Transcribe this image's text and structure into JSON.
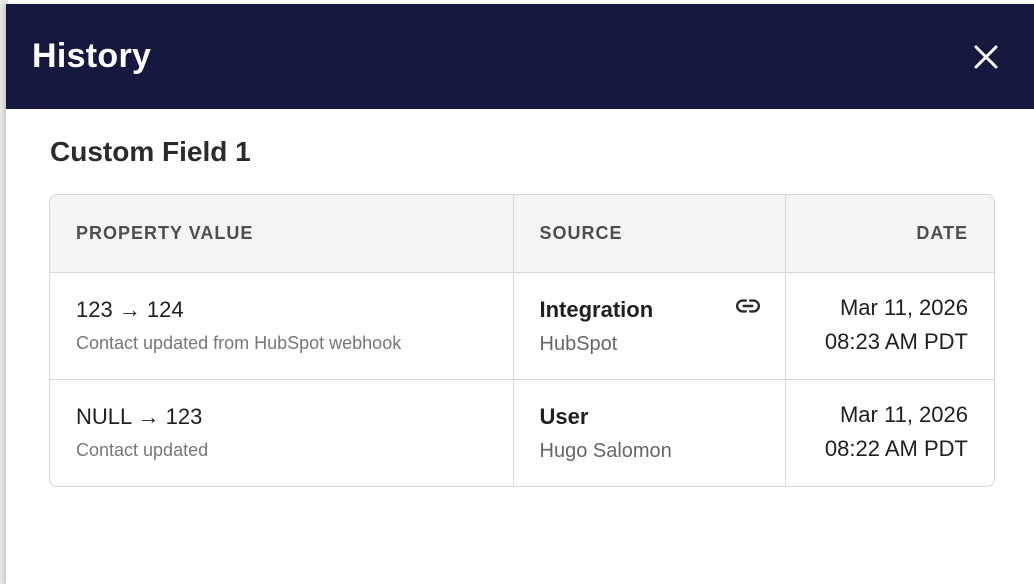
{
  "modal": {
    "title": "History",
    "close_icon": "close-icon",
    "field_name": "Custom Field 1"
  },
  "table": {
    "columns": [
      "PROPERTY VALUE",
      "SOURCE",
      "DATE"
    ],
    "rows": [
      {
        "change": "123 → 124",
        "note": "Contact updated from HubSpot webhook",
        "source_type": "Integration",
        "source_name": "HubSpot",
        "source_icon": "link-icon",
        "date": "Mar 11, 2026",
        "time": "08:23 AM PDT"
      },
      {
        "change": "NULL → 123",
        "note": "Contact updated",
        "source_type": "User",
        "source_name": "Hugo Salomon",
        "date": "Mar 11, 2026",
        "time": "08:22 AM PDT"
      }
    ]
  },
  "colors": {
    "header_bg": "#151940",
    "table_header_bg": "#f4f4f4",
    "border": "#d7d7d7"
  }
}
